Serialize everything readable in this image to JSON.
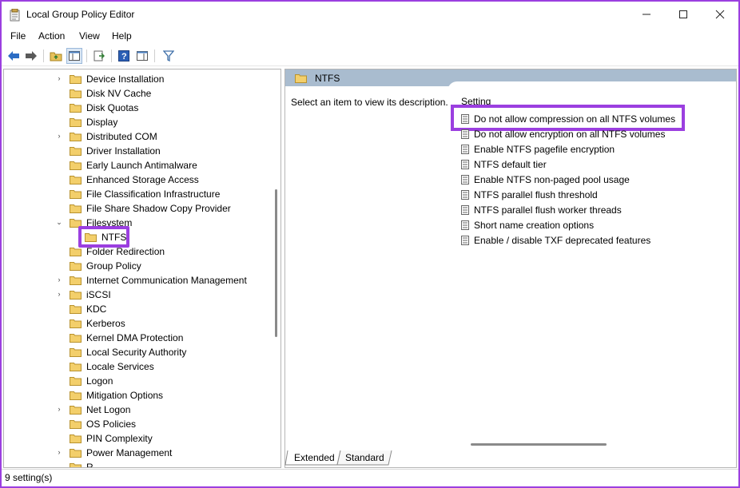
{
  "window": {
    "title": "Local Group Policy Editor",
    "minimize": "—",
    "maximize": "☐",
    "close": "✕"
  },
  "menu": [
    "File",
    "Action",
    "View",
    "Help"
  ],
  "tree": {
    "items": [
      {
        "label": "Device Installation",
        "chevron": "›"
      },
      {
        "label": "Disk NV Cache",
        "chevron": ""
      },
      {
        "label": "Disk Quotas",
        "chevron": ""
      },
      {
        "label": "Display",
        "chevron": ""
      },
      {
        "label": "Distributed COM",
        "chevron": "›"
      },
      {
        "label": "Driver Installation",
        "chevron": ""
      },
      {
        "label": "Early Launch Antimalware",
        "chevron": ""
      },
      {
        "label": "Enhanced Storage Access",
        "chevron": ""
      },
      {
        "label": "File Classification Infrastructure",
        "chevron": ""
      },
      {
        "label": "File Share Shadow Copy Provider",
        "chevron": ""
      },
      {
        "label": "Filesystem",
        "chevron": "⌄"
      },
      {
        "label": "NTFS",
        "chevron": ""
      },
      {
        "label": "Folder Redirection",
        "chevron": ""
      },
      {
        "label": "Group Policy",
        "chevron": ""
      },
      {
        "label": "Internet Communication Management",
        "chevron": "›"
      },
      {
        "label": "iSCSI",
        "chevron": "›"
      },
      {
        "label": "KDC",
        "chevron": ""
      },
      {
        "label": "Kerberos",
        "chevron": ""
      },
      {
        "label": "Kernel DMA Protection",
        "chevron": ""
      },
      {
        "label": "Local Security Authority",
        "chevron": ""
      },
      {
        "label": "Locale Services",
        "chevron": ""
      },
      {
        "label": "Logon",
        "chevron": ""
      },
      {
        "label": "Mitigation Options",
        "chevron": ""
      },
      {
        "label": "Net Logon",
        "chevron": "›"
      },
      {
        "label": "OS Policies",
        "chevron": ""
      },
      {
        "label": "PIN Complexity",
        "chevron": ""
      },
      {
        "label": "Power Management",
        "chevron": "›"
      },
      {
        "label": "R...",
        "chevron": ""
      }
    ]
  },
  "right_pane": {
    "header": "NTFS",
    "description": "Select an item to view its description.",
    "column_header": "Setting",
    "settings": [
      "Do not allow compression on all NTFS volumes",
      "Do not allow encryption on all NTFS volumes",
      "Enable NTFS pagefile encryption",
      "NTFS default tier",
      "Enable NTFS non-paged pool usage",
      "NTFS parallel flush threshold",
      "NTFS parallel flush worker threads",
      "Short name creation options",
      "Enable / disable TXF deprecated features"
    ]
  },
  "tabs": [
    "Extended",
    "Standard"
  ],
  "status": "9 setting(s)",
  "colors": {
    "highlight": "#9b3fe0",
    "header_bar": "#a9bccf"
  }
}
